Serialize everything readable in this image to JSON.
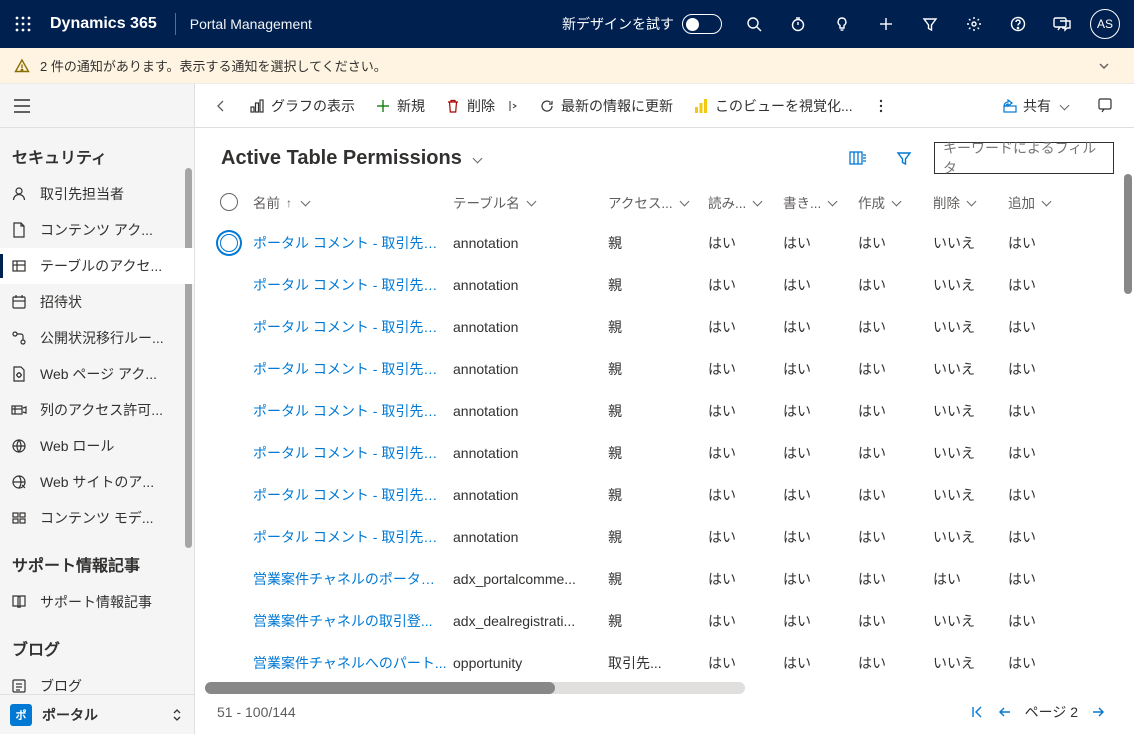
{
  "topbar": {
    "brand": "Dynamics 365",
    "subtitle": "Portal Management",
    "new_design": "新デザインを試す",
    "avatar": "AS"
  },
  "notification": {
    "text": "2 件の通知があります。表示する通知を選択してください。"
  },
  "sidebar": {
    "heading_security": "セキュリティ",
    "items_security": [
      "取引先担当者",
      "コンテンツ アク...",
      "テーブルのアクセ...",
      "招待状",
      "公開状況移行ルー...",
      "Web ページ アク...",
      "列のアクセス許可...",
      "Web ロール",
      "Web サイトのア...",
      "コンテンツ モデ..."
    ],
    "heading_support": "サポート情報記事",
    "items_support": [
      "サポート情報記事"
    ],
    "heading_blog": "ブログ",
    "items_blog": [
      "ブログ"
    ],
    "footer_badge": "ポ",
    "footer_label": "ポータル"
  },
  "commands": {
    "chart": "グラフの表示",
    "new": "新規",
    "delete": "削除",
    "refresh": "最新の情報に更新",
    "visualize": "このビューを視覚化...",
    "share": "共有"
  },
  "view": {
    "title": "Active Table Permissions",
    "filter_placeholder": "キーワードによるフィルタ"
  },
  "columns": {
    "name": "名前",
    "table": "テーブル名",
    "access": "アクセス...",
    "read": "読み...",
    "write": "書き...",
    "create": "作成",
    "delete": "削除",
    "append": "追加"
  },
  "rows": [
    {
      "name": "ポータル コメント - 取引先担...",
      "table": "annotation",
      "access": "親",
      "read": "はい",
      "write": "はい",
      "create": "はい",
      "delete": "いいえ",
      "append": "はい"
    },
    {
      "name": "ポータル コメント - 取引先担...",
      "table": "annotation",
      "access": "親",
      "read": "はい",
      "write": "はい",
      "create": "はい",
      "delete": "いいえ",
      "append": "はい"
    },
    {
      "name": "ポータル コメント - 取引先担...",
      "table": "annotation",
      "access": "親",
      "read": "はい",
      "write": "はい",
      "create": "はい",
      "delete": "いいえ",
      "append": "はい"
    },
    {
      "name": "ポータル コメント - 取引先担...",
      "table": "annotation",
      "access": "親",
      "read": "はい",
      "write": "はい",
      "create": "はい",
      "delete": "いいえ",
      "append": "はい"
    },
    {
      "name": "ポータル コメント - 取引先担...",
      "table": "annotation",
      "access": "親",
      "read": "はい",
      "write": "はい",
      "create": "はい",
      "delete": "いいえ",
      "append": "はい"
    },
    {
      "name": "ポータル コメント - 取引先担...",
      "table": "annotation",
      "access": "親",
      "read": "はい",
      "write": "はい",
      "create": "はい",
      "delete": "いいえ",
      "append": "はい"
    },
    {
      "name": "ポータル コメント - 取引先担...",
      "table": "annotation",
      "access": "親",
      "read": "はい",
      "write": "はい",
      "create": "はい",
      "delete": "いいえ",
      "append": "はい"
    },
    {
      "name": "ポータル コメント - 取引先担...",
      "table": "annotation",
      "access": "親",
      "read": "はい",
      "write": "はい",
      "create": "はい",
      "delete": "いいえ",
      "append": "はい"
    },
    {
      "name": "営業案件チャネルのポータル ...",
      "table": "adx_portalcomme...",
      "access": "親",
      "read": "はい",
      "write": "はい",
      "create": "はい",
      "delete": "はい",
      "append": "はい"
    },
    {
      "name": "営業案件チャネルの取引登...",
      "table": "adx_dealregistrati...",
      "access": "親",
      "read": "はい",
      "write": "はい",
      "create": "はい",
      "delete": "いいえ",
      "append": "はい"
    },
    {
      "name": "営業案件チャネルへのパート...",
      "table": "opportunity",
      "access": "取引先...",
      "read": "はい",
      "write": "はい",
      "create": "はい",
      "delete": "いいえ",
      "append": "はい"
    }
  ],
  "pager": {
    "info": "51 - 100/144",
    "page": "ページ 2"
  }
}
